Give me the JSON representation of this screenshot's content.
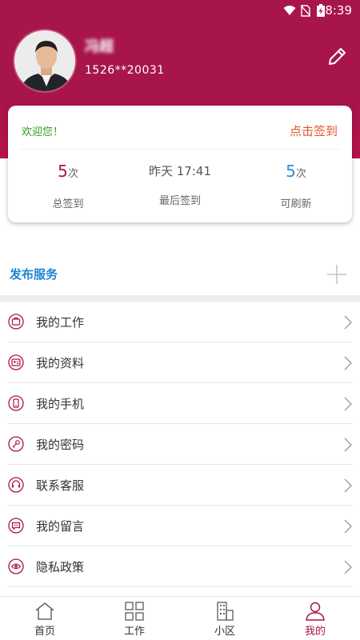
{
  "status_bar": {
    "time": "8:39",
    "icons": [
      "wifi-icon",
      "no-sim-icon",
      "battery-charging-icon"
    ]
  },
  "profile": {
    "name": "冯超",
    "phone": "1526**20031"
  },
  "checkin_card": {
    "welcome": "欢迎您！",
    "checkin_label": "点击签到",
    "stats": [
      {
        "value": "5",
        "unit": "次",
        "label": "总签到"
      },
      {
        "value": "昨天 17:41",
        "label": "最后签到"
      },
      {
        "value": "5",
        "unit": "次",
        "label": "可刷新"
      }
    ]
  },
  "publish": {
    "label": "发布服务"
  },
  "menu": [
    {
      "label": "我的工作",
      "icon": "briefcase-icon"
    },
    {
      "label": "我的资料",
      "icon": "profile-card-icon"
    },
    {
      "label": "我的手机",
      "icon": "phone-icon"
    },
    {
      "label": "我的密码",
      "icon": "key-icon"
    },
    {
      "label": "联系客服",
      "icon": "headset-icon"
    },
    {
      "label": "我的留言",
      "icon": "message-icon"
    },
    {
      "label": "隐私政策",
      "icon": "eye-icon"
    }
  ],
  "bottom_nav": [
    {
      "label": "首页",
      "icon": "home-icon",
      "active": false
    },
    {
      "label": "工作",
      "icon": "grid-icon",
      "active": false
    },
    {
      "label": "小区",
      "icon": "building-icon",
      "active": false
    },
    {
      "label": "我的",
      "icon": "person-icon",
      "active": true
    }
  ],
  "colors": {
    "brand": "#a8154a",
    "welcome_green": "#2e9e1a",
    "checkin_orange": "#e2572a",
    "accent_blue": "#1d86cf"
  }
}
